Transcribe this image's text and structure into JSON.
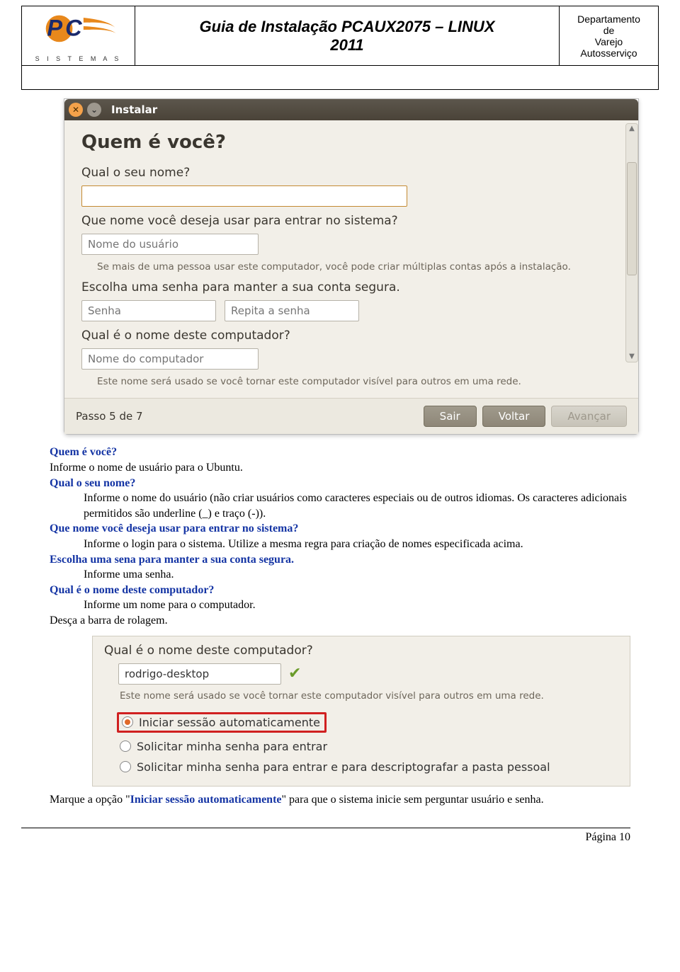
{
  "header": {
    "logo_brand_top": "PC",
    "logo_brand_bottom": "S I S T E M A S",
    "title_line1": "Guia de Instalação PCAUX2075 – LINUX",
    "title_line2": "2011",
    "dept_line1": "Departamento",
    "dept_line2": "de",
    "dept_line3": "Varejo",
    "dept_line4": "Autosserviço"
  },
  "screenshot1": {
    "win_title": "Instalar",
    "heading": "Quem é você?",
    "q_name": "Qual o seu nome?",
    "name_value": "",
    "q_loginname": "Que nome você deseja usar para entrar no sistema?",
    "login_placeholder": "Nome do usuário",
    "login_hint": "Se mais de uma pessoa usar este computador, você pode criar múltiplas contas após a instalação.",
    "q_password": "Escolha uma senha para manter a sua conta segura.",
    "pw_placeholder": "Senha",
    "pw2_placeholder": "Repita a senha",
    "q_hostname": "Qual é o nome deste computador?",
    "host_placeholder": "Nome do computador",
    "host_hint": "Este nome será usado se você tornar este computador visível para outros em uma rede.",
    "step": "Passo 5 de 7",
    "btn_quit": "Sair",
    "btn_back": "Voltar",
    "btn_next": "Avançar"
  },
  "bodytext": {
    "h1": "Quem é você?",
    "p1": "Informe o nome de usuário para o Ubuntu.",
    "h2": "Qual o seu nome?",
    "p2": "Informe o nome do usuário (não criar usuários como caracteres especiais ou de outros idiomas. Os caracteres adicionais permitidos são underline (_) e traço (-)).",
    "h3": "Que nome você deseja usar para entrar no sistema?",
    "p3": "Informe o login para o sistema. Utilize a mesma regra para criação de nomes especificada acima.",
    "h4": "Escolha uma sena para manter a sua conta segura.",
    "p4": "Informe uma senha.",
    "h5": "Qual é o nome deste computador?",
    "p5": "Informe um nome para o computador.",
    "p6": "Desça a barra de rolagem."
  },
  "screenshot2": {
    "q_hostname": "Qual é o nome deste computador?",
    "host_value": "rodrigo-desktop",
    "host_hint": "Este nome será usado se você tornar este computador visível para outros em uma rede.",
    "radio1": "Iniciar sessão automaticamente",
    "radio2": "Solicitar minha senha para entrar",
    "radio3": "Solicitar minha senha para entrar e para descriptografar a pasta pessoal"
  },
  "footer": {
    "pre": "Marque a opção \"",
    "bold": "Iniciar sessão automaticamente",
    "post": "\" para que o sistema inicie sem perguntar usuário e senha."
  },
  "page_number": "Página 10"
}
